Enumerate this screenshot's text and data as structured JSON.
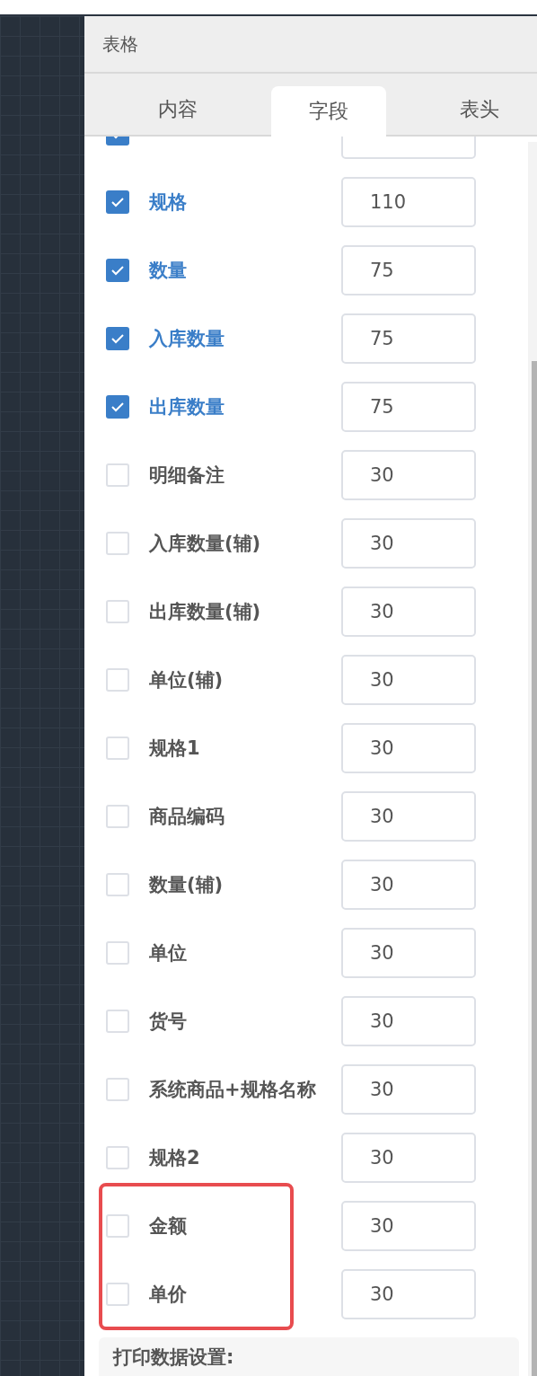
{
  "panel": {
    "title": "表格"
  },
  "tabs": [
    {
      "label": "内容",
      "selected": false
    },
    {
      "label": "字段",
      "selected": true
    },
    {
      "label": "表头",
      "selected": false
    }
  ],
  "fields": [
    {
      "checked": true
    },
    {
      "label": "规格",
      "value": "110",
      "checked": true,
      "highlighted": false
    },
    {
      "label": "数量",
      "value": "75",
      "checked": true,
      "highlighted": false
    },
    {
      "label": "入库数量",
      "value": "75",
      "checked": true,
      "highlighted": false
    },
    {
      "label": "出库数量",
      "value": "75",
      "checked": true,
      "highlighted": false
    },
    {
      "label": "明细备注",
      "value": "30",
      "checked": false,
      "highlighted": false
    },
    {
      "label": "入库数量(辅)",
      "value": "30",
      "checked": false,
      "highlighted": false
    },
    {
      "label": "出库数量(辅)",
      "value": "30",
      "checked": false,
      "highlighted": false
    },
    {
      "label": "单位(辅)",
      "value": "30",
      "checked": false,
      "highlighted": false
    },
    {
      "label": "规格1",
      "value": "30",
      "checked": false,
      "highlighted": false
    },
    {
      "label": "商品编码",
      "value": "30",
      "checked": false,
      "highlighted": false
    },
    {
      "label": "数量(辅)",
      "value": "30",
      "checked": false,
      "highlighted": false
    },
    {
      "label": "单位",
      "value": "30",
      "checked": false,
      "highlighted": false
    },
    {
      "label": "货号",
      "value": "30",
      "checked": false,
      "highlighted": false
    },
    {
      "label": "系统商品+规格名称",
      "value": "30",
      "checked": false,
      "highlighted": false
    },
    {
      "label": "规格2",
      "value": "30",
      "checked": false,
      "highlighted": false
    },
    {
      "label": "金额",
      "value": "30",
      "checked": false,
      "highlighted": true
    },
    {
      "label": "单价",
      "value": "30",
      "checked": false,
      "highlighted": true
    }
  ],
  "print_settings": {
    "title": "打印数据设置:"
  }
}
